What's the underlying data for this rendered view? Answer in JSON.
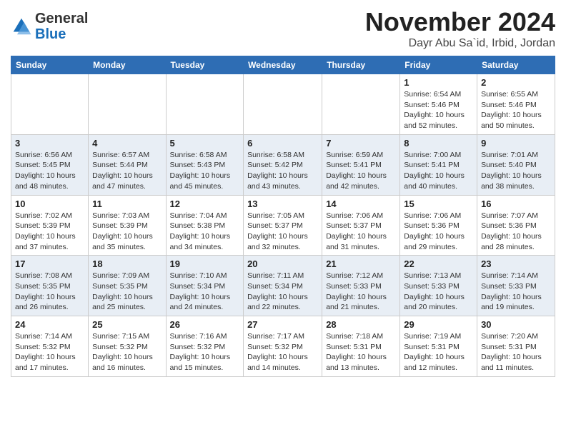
{
  "header": {
    "logo_line1": "General",
    "logo_line2": "Blue",
    "month": "November 2024",
    "location": "Dayr Abu Sa`id, Irbid, Jordan"
  },
  "weekdays": [
    "Sunday",
    "Monday",
    "Tuesday",
    "Wednesday",
    "Thursday",
    "Friday",
    "Saturday"
  ],
  "rows": [
    {
      "cells": [
        {
          "empty": true
        },
        {
          "empty": true
        },
        {
          "empty": true
        },
        {
          "empty": true
        },
        {
          "empty": true
        },
        {
          "day": "1",
          "sunrise": "6:54 AM",
          "sunset": "5:46 PM",
          "daylight": "10 hours and 52 minutes."
        },
        {
          "day": "2",
          "sunrise": "6:55 AM",
          "sunset": "5:46 PM",
          "daylight": "10 hours and 50 minutes."
        }
      ]
    },
    {
      "cells": [
        {
          "day": "3",
          "sunrise": "6:56 AM",
          "sunset": "5:45 PM",
          "daylight": "10 hours and 48 minutes."
        },
        {
          "day": "4",
          "sunrise": "6:57 AM",
          "sunset": "5:44 PM",
          "daylight": "10 hours and 47 minutes."
        },
        {
          "day": "5",
          "sunrise": "6:58 AM",
          "sunset": "5:43 PM",
          "daylight": "10 hours and 45 minutes."
        },
        {
          "day": "6",
          "sunrise": "6:58 AM",
          "sunset": "5:42 PM",
          "daylight": "10 hours and 43 minutes."
        },
        {
          "day": "7",
          "sunrise": "6:59 AM",
          "sunset": "5:41 PM",
          "daylight": "10 hours and 42 minutes."
        },
        {
          "day": "8",
          "sunrise": "7:00 AM",
          "sunset": "5:41 PM",
          "daylight": "10 hours and 40 minutes."
        },
        {
          "day": "9",
          "sunrise": "7:01 AM",
          "sunset": "5:40 PM",
          "daylight": "10 hours and 38 minutes."
        }
      ]
    },
    {
      "cells": [
        {
          "day": "10",
          "sunrise": "7:02 AM",
          "sunset": "5:39 PM",
          "daylight": "10 hours and 37 minutes."
        },
        {
          "day": "11",
          "sunrise": "7:03 AM",
          "sunset": "5:39 PM",
          "daylight": "10 hours and 35 minutes."
        },
        {
          "day": "12",
          "sunrise": "7:04 AM",
          "sunset": "5:38 PM",
          "daylight": "10 hours and 34 minutes."
        },
        {
          "day": "13",
          "sunrise": "7:05 AM",
          "sunset": "5:37 PM",
          "daylight": "10 hours and 32 minutes."
        },
        {
          "day": "14",
          "sunrise": "7:06 AM",
          "sunset": "5:37 PM",
          "daylight": "10 hours and 31 minutes."
        },
        {
          "day": "15",
          "sunrise": "7:06 AM",
          "sunset": "5:36 PM",
          "daylight": "10 hours and 29 minutes."
        },
        {
          "day": "16",
          "sunrise": "7:07 AM",
          "sunset": "5:36 PM",
          "daylight": "10 hours and 28 minutes."
        }
      ]
    },
    {
      "cells": [
        {
          "day": "17",
          "sunrise": "7:08 AM",
          "sunset": "5:35 PM",
          "daylight": "10 hours and 26 minutes."
        },
        {
          "day": "18",
          "sunrise": "7:09 AM",
          "sunset": "5:35 PM",
          "daylight": "10 hours and 25 minutes."
        },
        {
          "day": "19",
          "sunrise": "7:10 AM",
          "sunset": "5:34 PM",
          "daylight": "10 hours and 24 minutes."
        },
        {
          "day": "20",
          "sunrise": "7:11 AM",
          "sunset": "5:34 PM",
          "daylight": "10 hours and 22 minutes."
        },
        {
          "day": "21",
          "sunrise": "7:12 AM",
          "sunset": "5:33 PM",
          "daylight": "10 hours and 21 minutes."
        },
        {
          "day": "22",
          "sunrise": "7:13 AM",
          "sunset": "5:33 PM",
          "daylight": "10 hours and 20 minutes."
        },
        {
          "day": "23",
          "sunrise": "7:14 AM",
          "sunset": "5:33 PM",
          "daylight": "10 hours and 19 minutes."
        }
      ]
    },
    {
      "cells": [
        {
          "day": "24",
          "sunrise": "7:14 AM",
          "sunset": "5:32 PM",
          "daylight": "10 hours and 17 minutes."
        },
        {
          "day": "25",
          "sunrise": "7:15 AM",
          "sunset": "5:32 PM",
          "daylight": "10 hours and 16 minutes."
        },
        {
          "day": "26",
          "sunrise": "7:16 AM",
          "sunset": "5:32 PM",
          "daylight": "10 hours and 15 minutes."
        },
        {
          "day": "27",
          "sunrise": "7:17 AM",
          "sunset": "5:32 PM",
          "daylight": "10 hours and 14 minutes."
        },
        {
          "day": "28",
          "sunrise": "7:18 AM",
          "sunset": "5:31 PM",
          "daylight": "10 hours and 13 minutes."
        },
        {
          "day": "29",
          "sunrise": "7:19 AM",
          "sunset": "5:31 PM",
          "daylight": "10 hours and 12 minutes."
        },
        {
          "day": "30",
          "sunrise": "7:20 AM",
          "sunset": "5:31 PM",
          "daylight": "10 hours and 11 minutes."
        }
      ]
    }
  ]
}
